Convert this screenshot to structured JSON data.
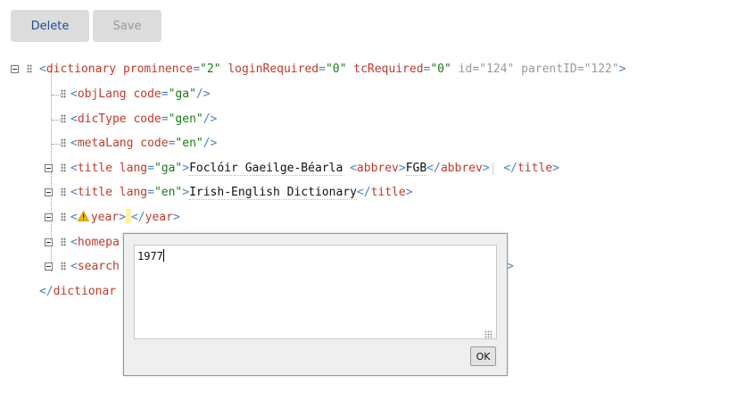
{
  "toolbar": {
    "delete_label": "Delete",
    "save_label": "Save"
  },
  "tree": {
    "root": {
      "name": "dictionary",
      "attrs": [
        {
          "name": "prominence",
          "value": "\"2\""
        },
        {
          "name": "loginRequired",
          "value": "\"0\""
        },
        {
          "name": "tcRequired",
          "value": "\"0\""
        }
      ],
      "readonly_attrs": [
        {
          "name": "id",
          "value": "\"124\""
        },
        {
          "name": "parentID",
          "value": "\"122\""
        }
      ],
      "close": "dictionar"
    },
    "objLang": {
      "name": "objLang",
      "attr": "code",
      "value": "\"ga\""
    },
    "dicType": {
      "name": "dicType",
      "attr": "code",
      "value": "\"gen\""
    },
    "metaLang": {
      "name": "metaLang",
      "attr": "code",
      "value": "\"en\""
    },
    "title_ga": {
      "name": "title",
      "attr": "lang",
      "value": "\"ga\"",
      "text": "Foclóir Gaeilge-Béarla",
      "abbrev_tag": "abbrev",
      "abbrev_text": "FGB"
    },
    "title_en": {
      "name": "title",
      "attr": "lang",
      "value": "\"en\"",
      "text": "Irish-English Dictionary"
    },
    "year": {
      "name": "year"
    },
    "homepage": {
      "partial": "homepa"
    },
    "search": {
      "partial": "search"
    }
  },
  "editor": {
    "value": "1977",
    "ok_label": "OK"
  },
  "icons": {
    "collapse": "minus-box-icon",
    "drag": "drag-handle-icon",
    "warning": "warning-icon"
  }
}
